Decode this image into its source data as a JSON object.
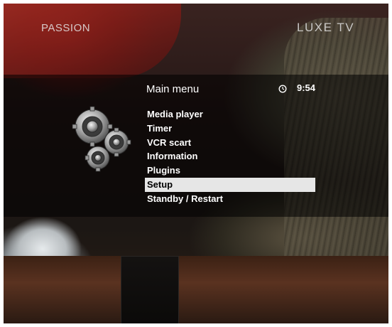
{
  "channel": {
    "left_name": "PASSION",
    "right_name": "LUXE TV"
  },
  "menu": {
    "title": "Main menu",
    "clock_icon": "clock-icon",
    "time": "9:54",
    "items": [
      {
        "label": "Media player",
        "selected": false
      },
      {
        "label": "Timer",
        "selected": false
      },
      {
        "label": "VCR scart",
        "selected": false
      },
      {
        "label": "Information",
        "selected": false
      },
      {
        "label": "Plugins",
        "selected": false
      },
      {
        "label": "Setup",
        "selected": true
      },
      {
        "label": "Standby / Restart",
        "selected": false
      }
    ]
  },
  "icons": {
    "menu_graphic": "gears-icon"
  },
  "colors": {
    "text": "#ffffff",
    "selection_background": "#e6e6e6",
    "selection_text": "#000000"
  }
}
